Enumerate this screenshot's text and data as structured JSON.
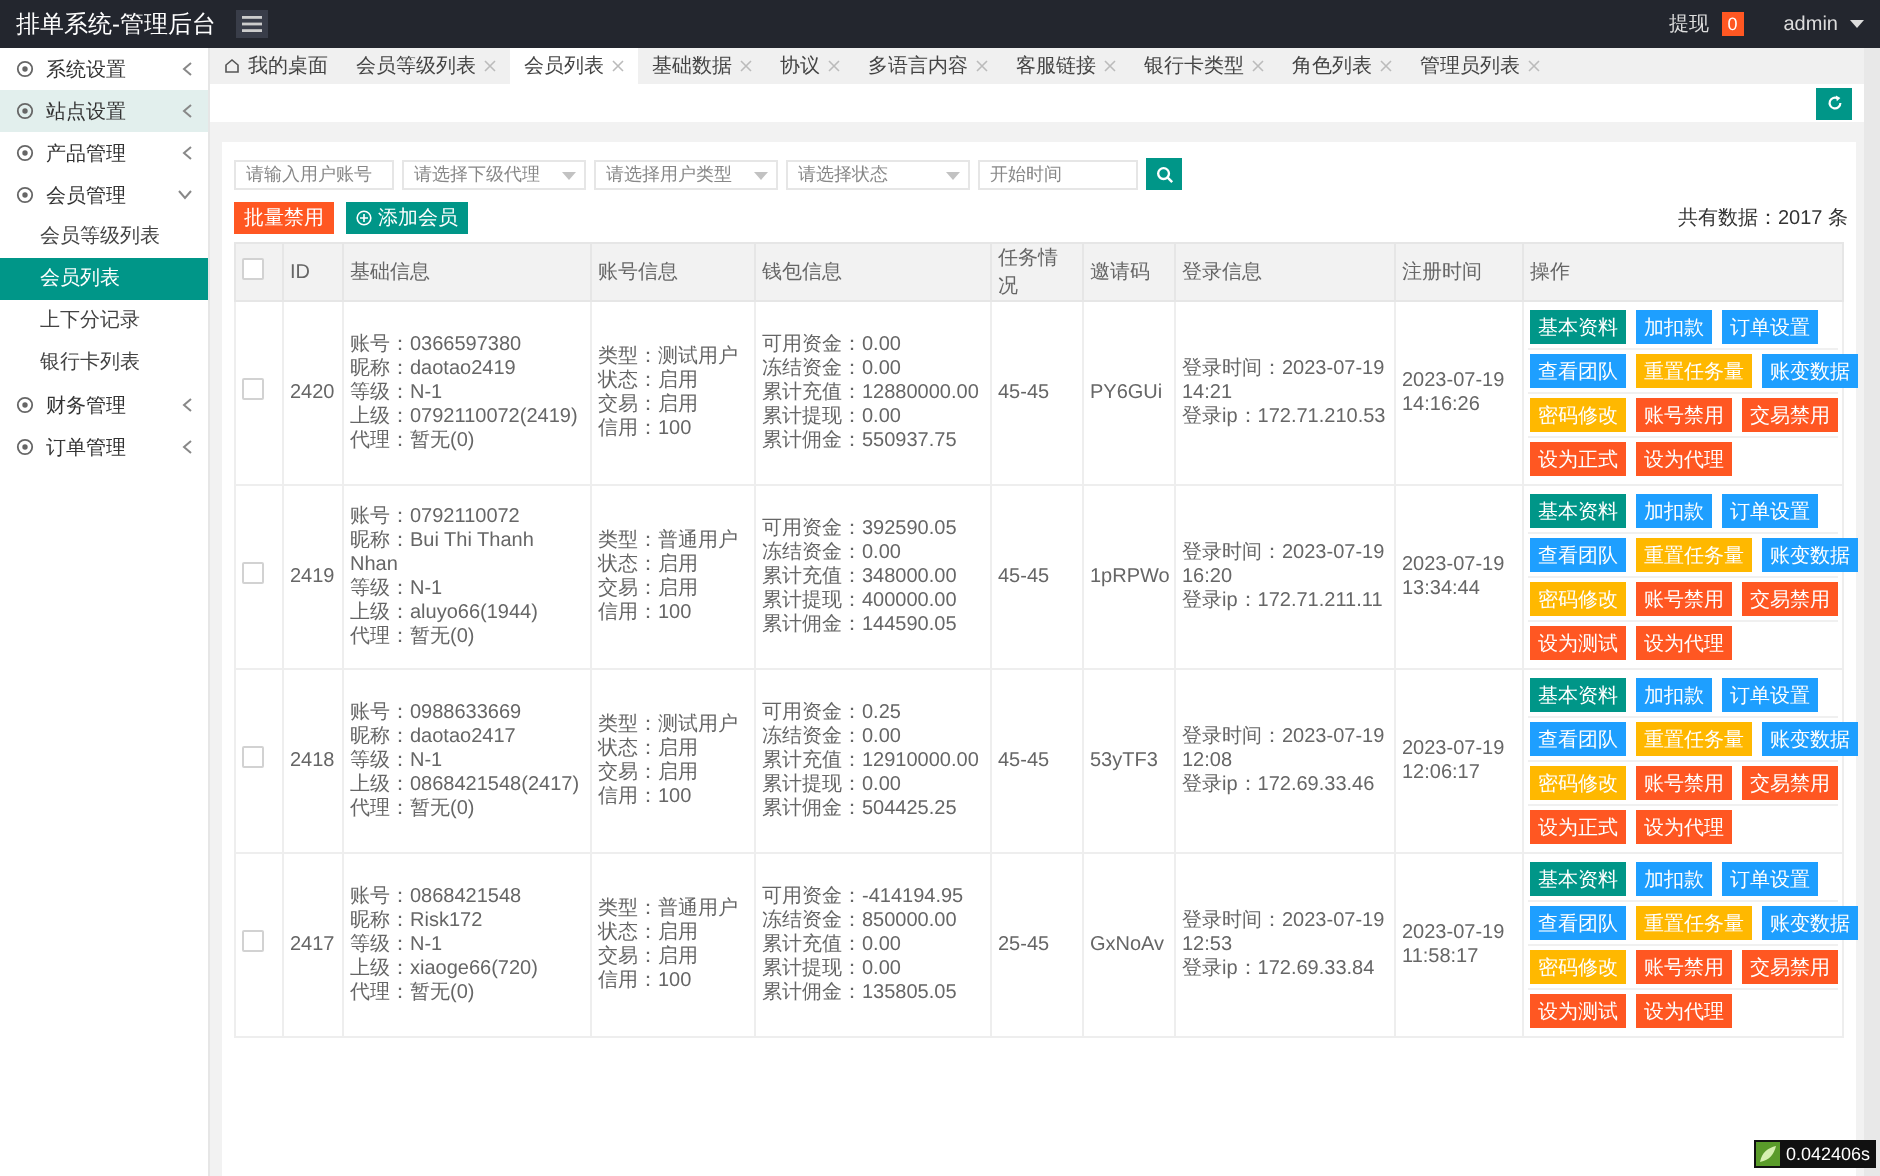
{
  "header": {
    "title": "排单系统-管理后台",
    "withdraw_label": "提现",
    "withdraw_count": "0",
    "user": "admin"
  },
  "sidebar": {
    "items": [
      {
        "label": "系统设置",
        "expanded": false,
        "hovered": false
      },
      {
        "label": "站点设置",
        "expanded": false,
        "hovered": true
      },
      {
        "label": "产品管理",
        "expanded": false,
        "hovered": false
      },
      {
        "label": "会员管理",
        "expanded": true,
        "hovered": false,
        "children": [
          {
            "label": "会员等级列表",
            "selected": false
          },
          {
            "label": "会员列表",
            "selected": true
          },
          {
            "label": "上下分记录",
            "selected": false
          },
          {
            "label": "银行卡列表",
            "selected": false
          }
        ]
      },
      {
        "label": "财务管理",
        "expanded": false,
        "hovered": false
      },
      {
        "label": "订单管理",
        "expanded": false,
        "hovered": false
      }
    ]
  },
  "tabs": [
    {
      "label": "我的桌面",
      "selected": false,
      "kind": "home"
    },
    {
      "label": "会员等级列表",
      "selected": false,
      "kind": "page"
    },
    {
      "label": "会员列表",
      "selected": true,
      "kind": "page"
    },
    {
      "label": "基础数据",
      "selected": false,
      "kind": "page"
    },
    {
      "label": "协议",
      "selected": false,
      "kind": "page"
    },
    {
      "label": "多语言内容",
      "selected": false,
      "kind": "page"
    },
    {
      "label": "客服链接",
      "selected": false,
      "kind": "page"
    },
    {
      "label": "银行卡类型",
      "selected": false,
      "kind": "page"
    },
    {
      "label": "角色列表",
      "selected": false,
      "kind": "page"
    },
    {
      "label": "管理员列表",
      "selected": false,
      "kind": "page"
    }
  ],
  "filters": [
    {
      "kind": "input",
      "placeholder": "请输入用户账号"
    },
    {
      "kind": "select",
      "placeholder": "请选择下级代理"
    },
    {
      "kind": "select",
      "placeholder": "请选择用户类型"
    },
    {
      "kind": "select",
      "placeholder": "请选择状态"
    },
    {
      "kind": "input",
      "placeholder": "开始时间"
    }
  ],
  "toolbar": {
    "buttons": [
      {
        "label": "批量禁用",
        "kind": "danger"
      },
      {
        "label": "添加会员",
        "kind": "add"
      }
    ],
    "total": "共有数据：2017 条"
  },
  "table": {
    "select_all_checked": false,
    "columns": [
      "ID",
      "基础信息",
      "账号信息",
      "钱包信息",
      "任务情况",
      "邀请码",
      "登录信息",
      "注册时间",
      "操作"
    ],
    "rows": [
      {
        "checked": false,
        "id": "2420",
        "basic": [
          "账号：0366597380",
          "昵称：daotao2419",
          "等级：N-1",
          "上级：0792110072(2419)",
          "代理：暂无(0)"
        ],
        "account": [
          "类型：测试用户",
          "状态：启用",
          "交易：启用",
          "信用：100"
        ],
        "wallet": [
          "可用资金：0.00",
          "冻结资金：0.00",
          "累计充值：12880000.00",
          "累计提现：0.00",
          "累计佣金：550937.75"
        ],
        "task": "45-45",
        "invite": "PY6GUi",
        "login": [
          "登录时间：2023-07-19 14:21",
          "登录ip：172.71.210.53"
        ],
        "registered": "2023-07-19 14:16:26",
        "actions": [
          [
            {
              "label": "基本资料",
              "kind": "primary"
            },
            {
              "label": "加扣款",
              "kind": "normal"
            },
            {
              "label": "订单设置",
              "kind": "normal"
            }
          ],
          [
            {
              "label": "查看团队",
              "kind": "normal"
            },
            {
              "label": "重置任务量",
              "kind": "warm"
            },
            {
              "label": "账变数据",
              "kind": "normal"
            }
          ],
          [
            {
              "label": "密码修改",
              "kind": "warm"
            },
            {
              "label": "账号禁用",
              "kind": "danger"
            },
            {
              "label": "交易禁用",
              "kind": "danger"
            }
          ],
          [
            {
              "label": "设为正式",
              "kind": "danger"
            },
            {
              "label": "设为代理",
              "kind": "danger"
            }
          ]
        ]
      },
      {
        "checked": false,
        "id": "2419",
        "basic": [
          "账号：0792110072",
          "昵称：Bui Thi Thanh Nhan",
          "等级：N-1",
          "上级：aluyo66(1944)",
          "代理：暂无(0)"
        ],
        "account": [
          "类型：普通用户",
          "状态：启用",
          "交易：启用",
          "信用：100"
        ],
        "wallet": [
          "可用资金：392590.05",
          "冻结资金：0.00",
          "累计充值：348000.00",
          "累计提现：400000.00",
          "累计佣金：144590.05"
        ],
        "task": "45-45",
        "invite": "1pRPWo",
        "login": [
          "登录时间：2023-07-19 16:20",
          "登录ip：172.71.211.11"
        ],
        "registered": "2023-07-19 13:34:44",
        "actions": [
          [
            {
              "label": "基本资料",
              "kind": "primary"
            },
            {
              "label": "加扣款",
              "kind": "normal"
            },
            {
              "label": "订单设置",
              "kind": "normal"
            }
          ],
          [
            {
              "label": "查看团队",
              "kind": "normal"
            },
            {
              "label": "重置任务量",
              "kind": "warm"
            },
            {
              "label": "账变数据",
              "kind": "normal"
            }
          ],
          [
            {
              "label": "密码修改",
              "kind": "warm"
            },
            {
              "label": "账号禁用",
              "kind": "danger"
            },
            {
              "label": "交易禁用",
              "kind": "danger"
            }
          ],
          [
            {
              "label": "设为测试",
              "kind": "danger"
            },
            {
              "label": "设为代理",
              "kind": "danger"
            }
          ]
        ]
      },
      {
        "checked": false,
        "id": "2418",
        "basic": [
          "账号：0988633669",
          "昵称：daotao2417",
          "等级：N-1",
          "上级：0868421548(2417)",
          "代理：暂无(0)"
        ],
        "account": [
          "类型：测试用户",
          "状态：启用",
          "交易：启用",
          "信用：100"
        ],
        "wallet": [
          "可用资金：0.25",
          "冻结资金：0.00",
          "累计充值：12910000.00",
          "累计提现：0.00",
          "累计佣金：504425.25"
        ],
        "task": "45-45",
        "invite": "53yTF3",
        "login": [
          "登录时间：2023-07-19 12:08",
          "登录ip：172.69.33.46"
        ],
        "registered": "2023-07-19 12:06:17",
        "actions": [
          [
            {
              "label": "基本资料",
              "kind": "primary"
            },
            {
              "label": "加扣款",
              "kind": "normal"
            },
            {
              "label": "订单设置",
              "kind": "normal"
            }
          ],
          [
            {
              "label": "查看团队",
              "kind": "normal"
            },
            {
              "label": "重置任务量",
              "kind": "warm"
            },
            {
              "label": "账变数据",
              "kind": "normal"
            }
          ],
          [
            {
              "label": "密码修改",
              "kind": "warm"
            },
            {
              "label": "账号禁用",
              "kind": "danger"
            },
            {
              "label": "交易禁用",
              "kind": "danger"
            }
          ],
          [
            {
              "label": "设为正式",
              "kind": "danger"
            },
            {
              "label": "设为代理",
              "kind": "danger"
            }
          ]
        ]
      },
      {
        "checked": false,
        "id": "2417",
        "basic": [
          "账号：0868421548",
          "昵称：Risk172",
          "等级：N-1",
          "上级：xiaoge66(720)",
          "代理：暂无(0)"
        ],
        "account": [
          "类型：普通用户",
          "状态：启用",
          "交易：启用",
          "信用：100"
        ],
        "wallet": [
          "可用资金：-414194.95",
          "冻结资金：850000.00",
          "累计充值：0.00",
          "累计提现：0.00",
          "累计佣金：135805.05"
        ],
        "task": "25-45",
        "invite": "GxNoAv",
        "login": [
          "登录时间：2023-07-19 12:53",
          "登录ip：172.69.33.84"
        ],
        "registered": "2023-07-19 11:58:17",
        "actions": [
          [
            {
              "label": "基本资料",
              "kind": "primary"
            },
            {
              "label": "加扣款",
              "kind": "normal"
            },
            {
              "label": "订单设置",
              "kind": "normal"
            }
          ],
          [
            {
              "label": "查看团队",
              "kind": "normal"
            },
            {
              "label": "重置任务量",
              "kind": "warm"
            },
            {
              "label": "账变数据",
              "kind": "normal"
            }
          ],
          [
            {
              "label": "密码修改",
              "kind": "warm"
            },
            {
              "label": "账号禁用",
              "kind": "danger"
            },
            {
              "label": "交易禁用",
              "kind": "danger"
            }
          ],
          [
            {
              "label": "设为测试",
              "kind": "danger"
            },
            {
              "label": "设为代理",
              "kind": "danger"
            }
          ]
        ]
      }
    ]
  },
  "debug_badge": "0.042406s"
}
